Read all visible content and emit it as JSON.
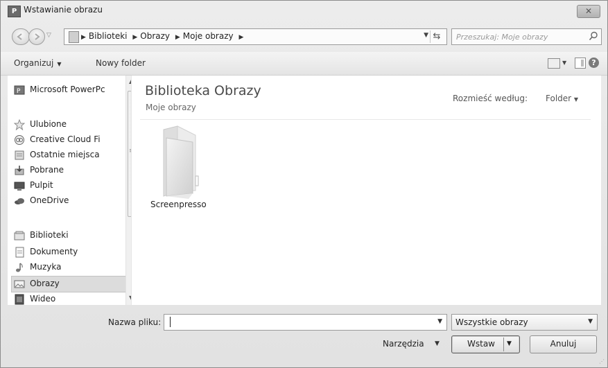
{
  "window": {
    "title": "Wstawianie obrazu",
    "app_icon_text": "P"
  },
  "address": {
    "crumbs": [
      "Biblioteki",
      "Obrazy",
      "Moje obrazy"
    ]
  },
  "search": {
    "placeholder": "Przeszukaj: Moje obrazy"
  },
  "toolbar": {
    "organize": "Organizuj",
    "new_folder": "Nowy folder"
  },
  "sidebar": {
    "items": [
      {
        "label": "Microsoft PowerPc",
        "icon": "powerpoint-icon"
      },
      {
        "label": "Ulubione",
        "icon": "star-icon"
      },
      {
        "label": "Creative Cloud Fi",
        "icon": "creative-cloud-icon"
      },
      {
        "label": "Ostatnie miejsca",
        "icon": "recent-places-icon"
      },
      {
        "label": "Pobrane",
        "icon": "downloads-icon"
      },
      {
        "label": "Pulpit",
        "icon": "desktop-icon"
      },
      {
        "label": "OneDrive",
        "icon": "onedrive-icon"
      },
      {
        "label": "Biblioteki",
        "icon": "libraries-icon"
      },
      {
        "label": "Dokumenty",
        "icon": "documents-icon"
      },
      {
        "label": "Muzyka",
        "icon": "music-icon"
      },
      {
        "label": "Obrazy",
        "icon": "pictures-icon",
        "selected": true
      },
      {
        "label": "Wideo",
        "icon": "video-icon"
      }
    ]
  },
  "content": {
    "library_title": "Biblioteka Obrazy",
    "library_subtitle": "Moje obrazy",
    "arrange_label": "Rozmieść według:",
    "arrange_value": "Folder",
    "items": [
      {
        "name": "Screenpresso",
        "icon": "folder-icon"
      }
    ]
  },
  "footer": {
    "filename_label": "Nazwa pliku:",
    "filename_value": "",
    "filetype": "Wszystkie obrazy",
    "tools": "Narzędzia",
    "insert": "Wstaw",
    "cancel": "Anuluj"
  }
}
